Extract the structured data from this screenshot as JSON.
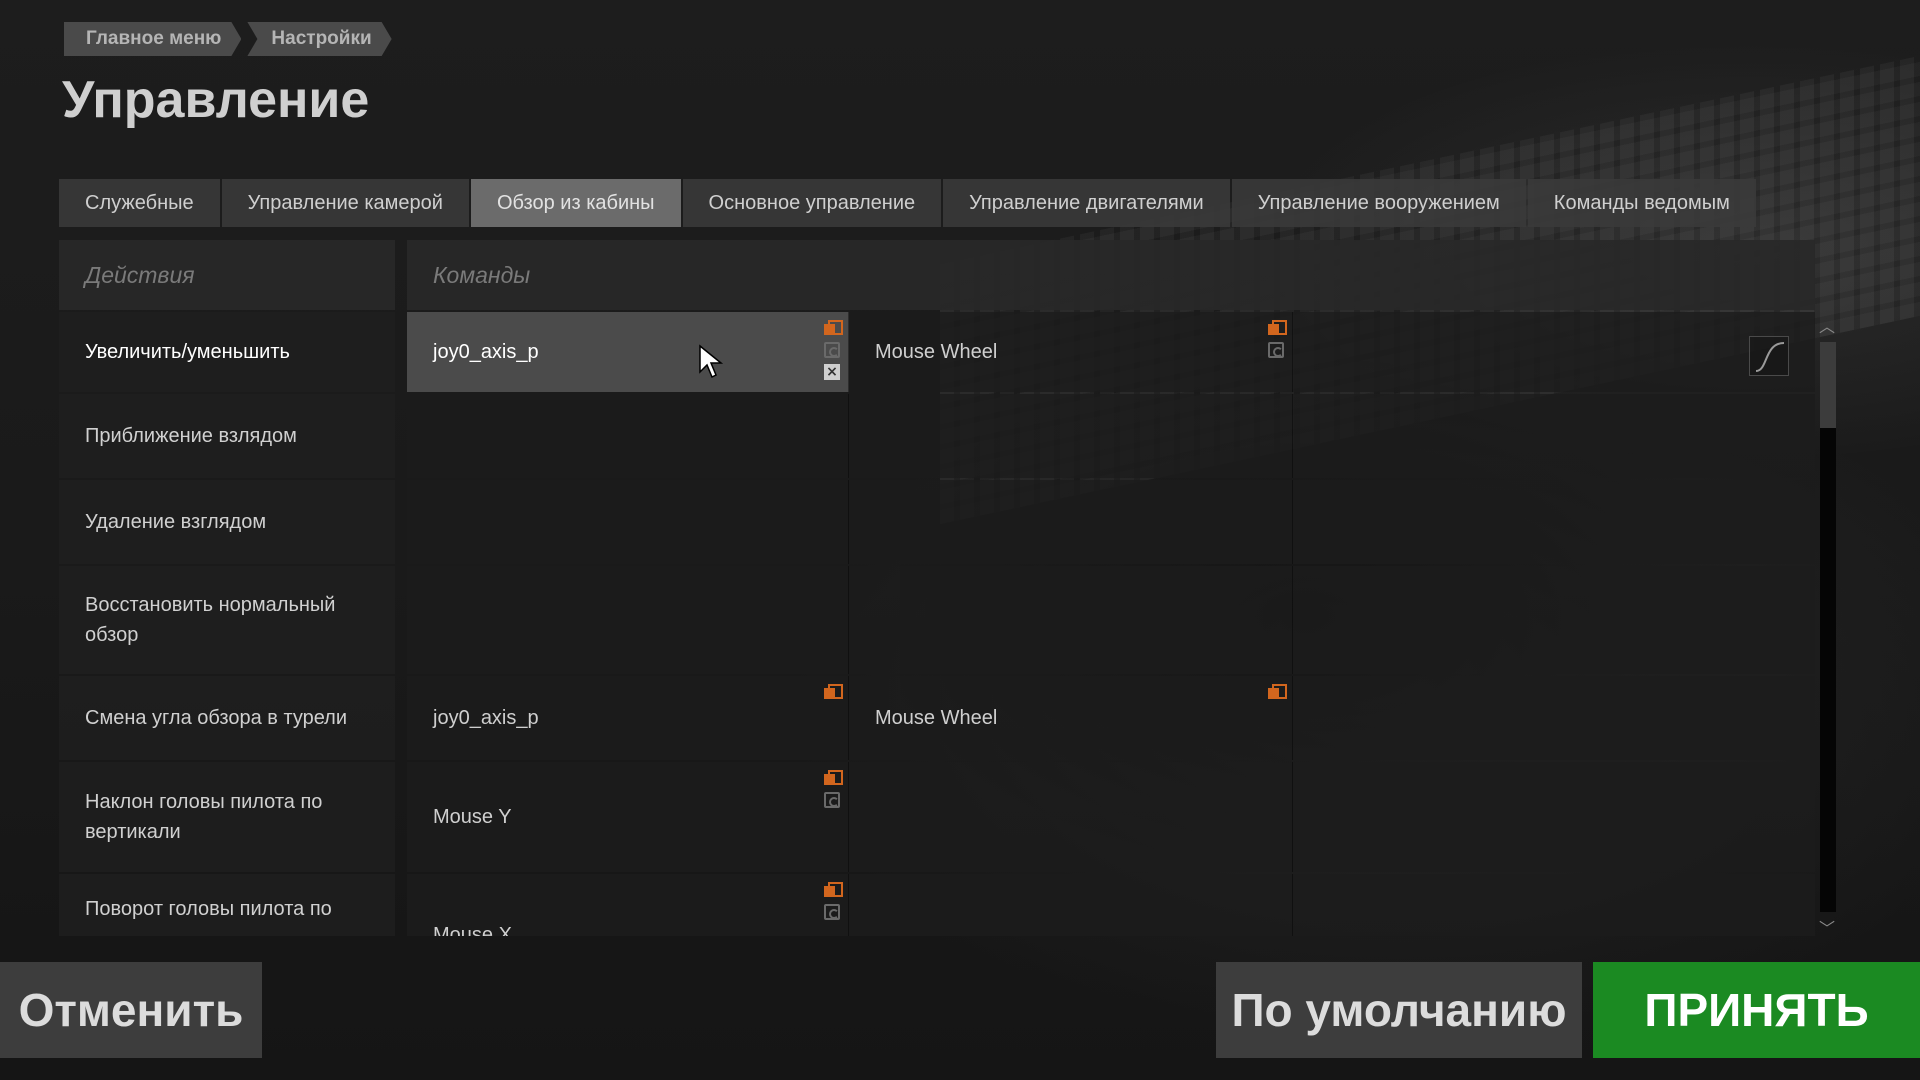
{
  "breadcrumb": [
    "Главное меню",
    "Настройки"
  ],
  "title": "Управление",
  "tabs": [
    {
      "label": "Служебные",
      "active": false
    },
    {
      "label": "Управление камерой",
      "active": false
    },
    {
      "label": "Обзор из кабины",
      "active": true
    },
    {
      "label": "Основное управление",
      "active": false
    },
    {
      "label": "Управление двигателями",
      "active": false
    },
    {
      "label": "Управление вооружением",
      "active": false
    },
    {
      "label": "Команды ведомым",
      "active": false
    }
  ],
  "table": {
    "header_actions": "Действия",
    "header_commands": "Команды",
    "rows": [
      {
        "action": "Увеличить/уменьшить",
        "bind1": "joy0_axis_p",
        "bind2": "Mouse Wheel"
      },
      {
        "action": "Приближение взлядом",
        "bind1": "",
        "bind2": ""
      },
      {
        "action": "Удаление взглядом",
        "bind1": "",
        "bind2": ""
      },
      {
        "action": "Восстановить нормальный обзор",
        "bind1": "",
        "bind2": ""
      },
      {
        "action": "Смена угла обзора в турели",
        "bind1": "joy0_axis_p",
        "bind2": "Mouse Wheel"
      },
      {
        "action": "Наклон головы пилота по вертикали",
        "bind1": "Mouse Y",
        "bind2": ""
      },
      {
        "action": "Поворот головы пилота по",
        "bind1": "Mouse X",
        "bind2": ""
      }
    ]
  },
  "buttons": {
    "cancel": "Отменить",
    "default": "По умолчанию",
    "accept": "ПРИНЯТЬ"
  },
  "colors": {
    "accent_orange": "#d2661e",
    "accept_green": "#1b8a22"
  }
}
